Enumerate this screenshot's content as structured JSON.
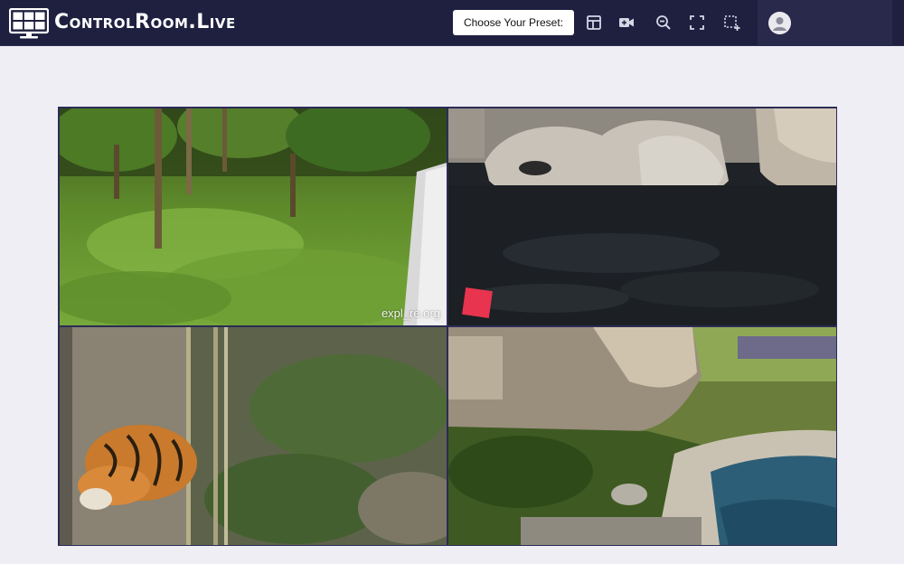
{
  "header": {
    "brand": "ControlRoom.Live",
    "preset_label": "Choose Your Preset:",
    "toolbar": [
      "layout-icon",
      "video-camera-icon",
      "zoom-out-icon",
      "fullscreen-icon",
      "region-select-icon"
    ],
    "account": "user-avatar-icon"
  },
  "cameras": [
    {
      "scene": "forest enclosure with grass and trees",
      "watermark": "expl_re.org"
    },
    {
      "scene": "rocky pool enclosure",
      "watermark": ""
    },
    {
      "scene": "tiger sleeping beside bamboo and ferns",
      "watermark": ""
    },
    {
      "scene": "rock cliff with pond and grass",
      "watermark": ""
    }
  ],
  "colors": {
    "topbar": "#1f2040",
    "page_background": "#efeef4",
    "grid_border": "#2b2c55",
    "preset_button": "#ffffff"
  }
}
